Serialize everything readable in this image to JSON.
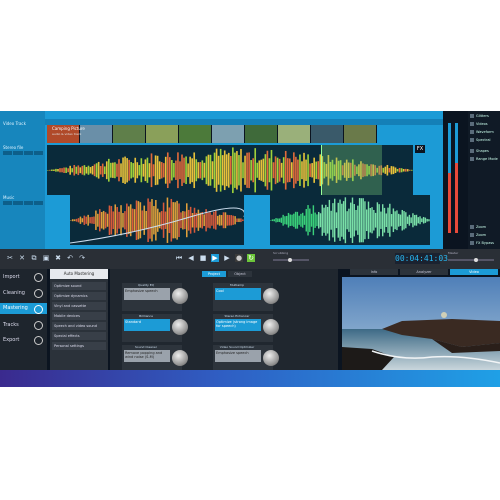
{
  "editor": {
    "track_labels": [
      "Video Track",
      "Stereo file",
      "Music"
    ],
    "thumb_title": "Camping Picture",
    "thumb_subtitle": "audio & video track",
    "fx_label": "FX"
  },
  "side_panel": {
    "items": [
      "Glitters",
      "Videos",
      "Waveform",
      "Spectral",
      "Shapes",
      "Range Mode"
    ],
    "bottom_items": [
      "Zoom",
      "Zoom",
      "FX Bypass"
    ]
  },
  "transport": {
    "time": "00:04:41:03",
    "scrubbing_label": "Scrubbing",
    "master_label": "Master",
    "buttons": [
      "rewind",
      "previous",
      "stop",
      "play",
      "next",
      "record",
      "loop"
    ]
  },
  "left_nav": {
    "items": [
      {
        "label": "Import",
        "active": false
      },
      {
        "label": "Cleaning",
        "active": false
      },
      {
        "label": "Mastering",
        "active": true
      },
      {
        "label": "Tracks",
        "active": false
      },
      {
        "label": "Export",
        "active": false
      }
    ]
  },
  "sublist": {
    "header": "Auto Mastering",
    "items": [
      "Optimize sound",
      "Optimize dynamics",
      "Vinyl and cassette",
      "Mobile devices",
      "Speech and video sound",
      "Special effects",
      "Personal settings"
    ]
  },
  "grid": {
    "tabs": [
      "Project",
      "Object"
    ],
    "cards": [
      {
        "header": "Quality EQ",
        "value": "Emphasize speech",
        "grey": true
      },
      {
        "header": "Multiamp",
        "value": "Cool",
        "grey": false
      },
      {
        "header": "Brilliance",
        "value": "Standard",
        "grey": false
      },
      {
        "header": "Stereo Enhancer",
        "value": "Optimize (strong image for speech)",
        "grey": false
      },
      {
        "header": "Sound Cleaner",
        "value": "Remove popping and wind noise (S-M)",
        "grey": true
      },
      {
        "header": "Video Sound Optimizer",
        "value": "Emphasize speech",
        "grey": true
      }
    ]
  },
  "preview": {
    "tabs": [
      {
        "label": "Info",
        "on": false
      },
      {
        "label": "Analyzer",
        "on": false
      },
      {
        "label": "Video",
        "on": true
      }
    ]
  },
  "colors": {
    "accent": "#1c9bd6",
    "green": "#6cc63a",
    "record": "#e84a3a"
  }
}
